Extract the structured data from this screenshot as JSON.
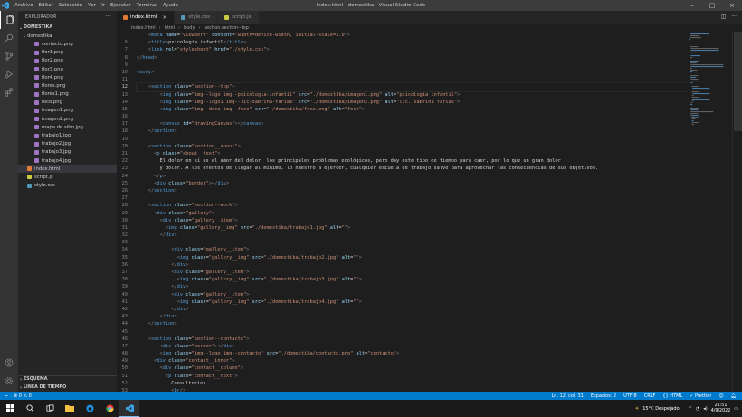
{
  "titlebar": {
    "menu": [
      "Archivo",
      "Editar",
      "Selección",
      "Ver",
      "Ir",
      "Ejecutar",
      "Terminal",
      "Ayuda"
    ],
    "title": "index.html - domestika - Visual Studio Code"
  },
  "sidebar": {
    "title": "EXPLORADOR",
    "root": "DOMESTIKA",
    "folder": "domestika",
    "files": [
      {
        "name": "contacto.png",
        "type": "png"
      },
      {
        "name": "flor1.png",
        "type": "png"
      },
      {
        "name": "flor2.png",
        "type": "png"
      },
      {
        "name": "flor3.png",
        "type": "png"
      },
      {
        "name": "flor4.png",
        "type": "png"
      },
      {
        "name": "flores.png",
        "type": "png"
      },
      {
        "name": "flores1.png",
        "type": "png"
      },
      {
        "name": "foco.png",
        "type": "png"
      },
      {
        "name": "imagen1.png",
        "type": "png"
      },
      {
        "name": "imagen2.png",
        "type": "png"
      },
      {
        "name": "mapa de sitio.jpg",
        "type": "png"
      },
      {
        "name": "trabajo1.jpg",
        "type": "png"
      },
      {
        "name": "trabajo2.jpg",
        "type": "png"
      },
      {
        "name": "trabajo3.jpg",
        "type": "png"
      },
      {
        "name": "trabajo4.jpg",
        "type": "png"
      }
    ],
    "root_files": [
      {
        "name": "index.html",
        "type": "html",
        "selected": true
      },
      {
        "name": "script.js",
        "type": "js",
        "selected": false
      },
      {
        "name": "style.css",
        "type": "css",
        "selected": false
      }
    ],
    "outline": "ESQUEMA",
    "timeline": "LÍNEA DE TIEMPO"
  },
  "tabs": [
    {
      "label": "index.html",
      "type": "html",
      "active": true
    },
    {
      "label": "style.css",
      "type": "css",
      "active": false
    },
    {
      "label": "script.js",
      "type": "js",
      "active": false
    }
  ],
  "breadcrumb": [
    "index.html",
    "html",
    "body",
    "section.section--top"
  ],
  "code_lines": [
    {
      "n": "",
      "t": "    <meta name=\"viewport\" content=\"width=device-width, initial-scale=1.0\">"
    },
    {
      "n": "6",
      "t": "    <title>psicologia infantil</title>"
    },
    {
      "n": "7",
      "t": "    <link rel=\"stylesheet\" href=\"./style.css\">"
    },
    {
      "n": "8",
      "t": "</head>"
    },
    {
      "n": "9",
      "t": ""
    },
    {
      "n": "10",
      "t": "<body>"
    },
    {
      "n": "11",
      "t": ""
    },
    {
      "n": "12",
      "t": "    <section class=\"section--top\">",
      "cur": true
    },
    {
      "n": "13",
      "t": "        <img class=\"img--logo img--psicologia-infantil\" src=\"./domestika/imagen1.png\" alt=\"psicologia infantil\">"
    },
    {
      "n": "14",
      "t": "        <img class=\"img--logo1 img--lic-sabrina-farias\" src=\"./domestika/imagen2.png\" alt=\"lic. sabrina farias\">"
    },
    {
      "n": "15",
      "t": "        <img class=\"img--deco img--foco\" src=\"./domestika/foco.png\" alt=\"foco\">"
    },
    {
      "n": "16",
      "t": ""
    },
    {
      "n": "17",
      "t": "        <canvas id=\"drawingCanvas\"></canvas>"
    },
    {
      "n": "18",
      "t": "    </section>"
    },
    {
      "n": "19",
      "t": ""
    },
    {
      "n": "20",
      "t": "    <section class=\"section__about\">"
    },
    {
      "n": "21",
      "t": "      <p class=\"about__text\">"
    },
    {
      "n": "22",
      "t": "        El dolor en sí es el amor del dolor, los principales problemas ecológicos, pero doy este tipo de tiempo para caer, por lo que un gran dolor"
    },
    {
      "n": "23",
      "t": "        y dolor. A los efectos de llegar al mínimo, lo nuestro a ejercer, cualquier escuela de trabajo salvo para aprovechar las consecuencias de sus objetivos."
    },
    {
      "n": "24",
      "t": "      </p>"
    },
    {
      "n": "25",
      "t": "      <div class=\"border\"></div>"
    },
    {
      "n": "26",
      "t": "    </section>"
    },
    {
      "n": "27",
      "t": ""
    },
    {
      "n": "28",
      "t": "    <section class=\"section--work\">"
    },
    {
      "n": "29",
      "t": "      <div class=\"gallery\">"
    },
    {
      "n": "30",
      "t": "        <div class=\"gallery__item\">"
    },
    {
      "n": "31",
      "t": "          <img class=\"gallery__img\" src=\"./domestika/trabajo1.jpg\" alt=\"\">"
    },
    {
      "n": "32",
      "t": "        </div>"
    },
    {
      "n": "33",
      "t": ""
    },
    {
      "n": "34",
      "t": "            <div class=\"gallery__item\">"
    },
    {
      "n": "35",
      "t": "              <img class=\"gallery__img\" src=\"./domestika/trabajo2.jpg\" alt=\"\">"
    },
    {
      "n": "36",
      "t": "            </div>"
    },
    {
      "n": "37",
      "t": "            <div class=\"gallery__item\">"
    },
    {
      "n": "38",
      "t": "              <img class=\"gallery__img\" src=\"./domestika/trabajo3.jpg\" alt=\"\">"
    },
    {
      "n": "39",
      "t": "            </div>"
    },
    {
      "n": "40",
      "t": "            <div class=\"gallery__item\">"
    },
    {
      "n": "41",
      "t": "              <img class=\"gallery__img\" src=\"./domestika/trabajo4.jpg\" alt=\"\">"
    },
    {
      "n": "42",
      "t": "            </div>"
    },
    {
      "n": "43",
      "t": "        </div>"
    },
    {
      "n": "44",
      "t": "    </section>"
    },
    {
      "n": "45",
      "t": ""
    },
    {
      "n": "46",
      "t": "    <section class=\"section--contacto\">"
    },
    {
      "n": "47",
      "t": "        <div class=\"border\"></div>"
    },
    {
      "n": "48",
      "t": "        <img class=\"img--logo img--contacto\" src=\"./domestika/contacto.png\" alt=\"contacto\">"
    },
    {
      "n": "49",
      "t": "      <div class=\"contact__inner\">"
    },
    {
      "n": "50",
      "t": "        <div class=\"contact__column\">"
    },
    {
      "n": "51",
      "t": "          <p class=\"contact__text\">"
    },
    {
      "n": "52",
      "t": "            Consultorios"
    },
    {
      "n": "53",
      "t": "            <br/>"
    },
    {
      "n": "54",
      "t": "            Moron: santa catalina 947"
    },
    {
      "n": "55",
      "t": "            <br/>"
    }
  ],
  "statusbar": {
    "errors": "0",
    "warnings": "0",
    "position": "Ln. 12, col. 31",
    "spaces": "Espacios: 2",
    "encoding": "UTF-8",
    "eol": "CRLF",
    "language": "HTML",
    "prettier": "Prettier"
  },
  "taskbar": {
    "weather": "15°C  Despejado",
    "time": "21:51",
    "date": "4/9/2022"
  },
  "colors": {
    "tag": "#569cd6",
    "attr": "#9cdcfe",
    "string": "#ce9178",
    "text": "#d4d4d4",
    "status": "#007acc"
  }
}
